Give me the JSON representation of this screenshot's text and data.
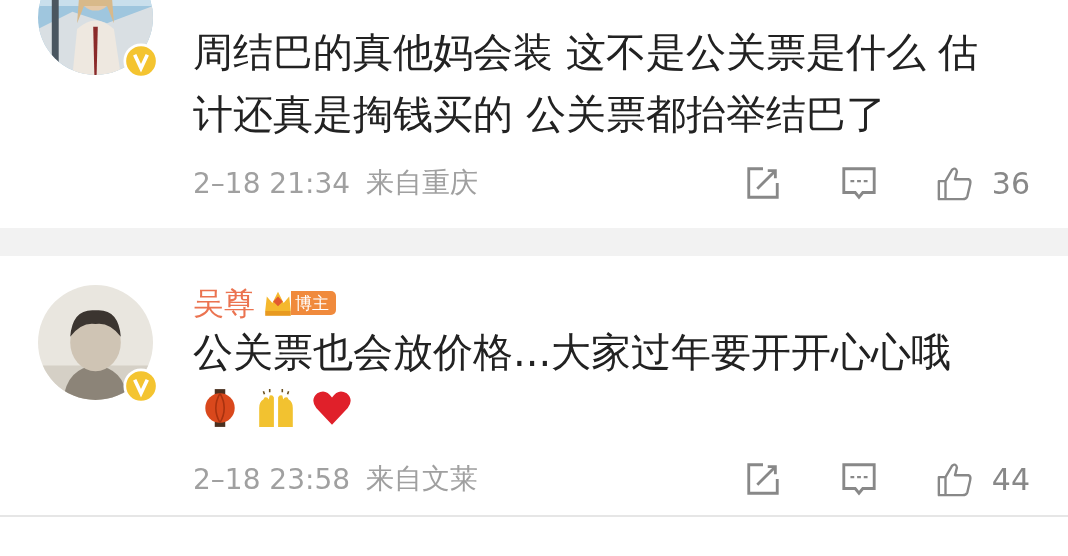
{
  "comments": [
    {
      "verified": true,
      "text": "周结巴的真他妈会装 这不是公关票是什么 估计还真是掏钱买的 公关票都抬举结巴了",
      "time": "2–18 21:34",
      "source": "来自重庆",
      "likes": "36"
    },
    {
      "author": "吴尊",
      "badge": "博主",
      "verified": true,
      "text": "公关票也会放价格...大家过年要开开心心哦",
      "emoji": [
        {
          "kind": "lantern"
        },
        {
          "kind": "raised_hands"
        },
        {
          "kind": "heart"
        }
      ],
      "time": "2–18 23:58",
      "source": "来自文莱",
      "likes": "44"
    }
  ]
}
